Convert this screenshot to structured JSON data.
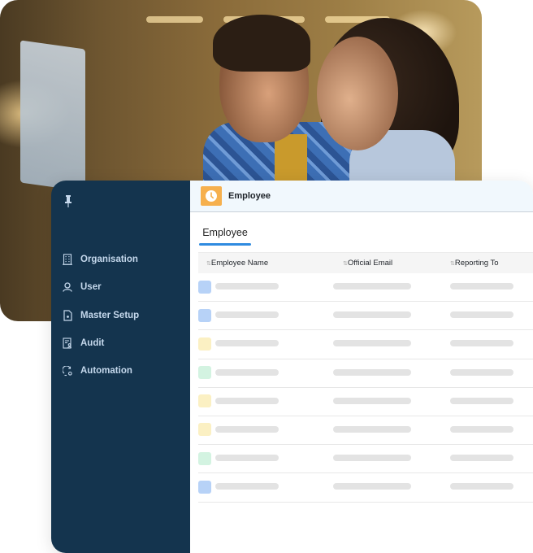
{
  "photo": {
    "description": "two-colleagues-looking-at-laptop"
  },
  "sidebar": {
    "pin_icon": "pushpin-icon",
    "items": [
      {
        "label": "Organisation",
        "icon": "building-icon"
      },
      {
        "label": "User",
        "icon": "user-icon"
      },
      {
        "label": "Master Setup",
        "icon": "document-icon"
      },
      {
        "label": "Audit",
        "icon": "audit-report-icon"
      },
      {
        "label": "Automation",
        "icon": "automation-icon"
      }
    ]
  },
  "header": {
    "logo_icon": "clock-icon",
    "title": "Employee",
    "accent": "#f6b04e"
  },
  "tabs": [
    {
      "label": "Employee",
      "active": true
    }
  ],
  "table": {
    "sort_icon": "⇅",
    "columns": [
      "Employee Name",
      "Official Email",
      "Reporting To"
    ],
    "rows": [
      {
        "avatar_color": "#b7d2f7",
        "loading": true
      },
      {
        "avatar_color": "#b7d2f7",
        "loading": true
      },
      {
        "avatar_color": "#fbf0c3",
        "loading": true
      },
      {
        "avatar_color": "#d3f3e1",
        "loading": true
      },
      {
        "avatar_color": "#fbf0c3",
        "loading": true
      },
      {
        "avatar_color": "#fbf0c3",
        "loading": true
      },
      {
        "avatar_color": "#d3f3e1",
        "loading": true
      },
      {
        "avatar_color": "#b7d2f7",
        "loading": true
      }
    ]
  },
  "colors": {
    "sidebar_bg": "#14344e",
    "sidebar_text": "#c5d8ec",
    "tab_underline": "#2f8be0",
    "header_bg": "#f1f8fd",
    "skeleton": "#e3e3e3"
  }
}
